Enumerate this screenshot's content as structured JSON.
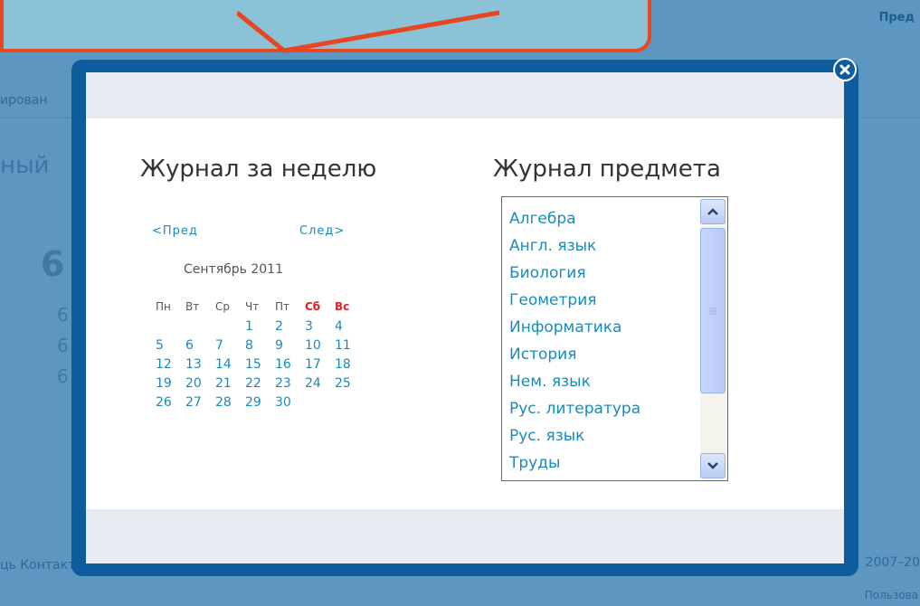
{
  "background": {
    "top_right": "Пред",
    "left_text_1": "ирован",
    "left_text_2": "ный",
    "big_number": "6",
    "small_numbers": [
      "6",
      "6",
      "6"
    ],
    "footer_left": "ць   Контакты",
    "footer_right": "2007–20",
    "footer_right_2": "Пользова"
  },
  "modal": {
    "week_journal_title": "Журнал за неделю",
    "subject_journal_title": "Журнал предмета",
    "close_icon": "close-icon",
    "calendar": {
      "prev_label": "<Пред",
      "next_label": "След>",
      "month_label": "Сентябрь 2011",
      "weekdays": [
        "Пн",
        "Вт",
        "Ср",
        "Чт",
        "Пт",
        "Сб",
        "Вс"
      ],
      "weeks": [
        [
          "",
          "",
          "",
          "1",
          "2",
          "3",
          "4"
        ],
        [
          "5",
          "6",
          "7",
          "8",
          "9",
          "10",
          "11"
        ],
        [
          "12",
          "13",
          "14",
          "15",
          "16",
          "17",
          "18"
        ],
        [
          "19",
          "20",
          "21",
          "22",
          "23",
          "24",
          "25"
        ],
        [
          "26",
          "27",
          "28",
          "29",
          "30",
          "",
          ""
        ]
      ]
    },
    "subjects": [
      "Алгебра",
      "Англ. язык",
      "Биология",
      "Геометрия",
      "Информатика",
      "История",
      "Нем. язык",
      "Рус. литература",
      "Рус. язык",
      "Труды"
    ]
  },
  "colors": {
    "modal_border": "#0e5c9b",
    "link": "#1a8ab8",
    "weekend": "#e02020",
    "callout_border": "#e8461f",
    "callout_fill": "#8cc2d8"
  }
}
